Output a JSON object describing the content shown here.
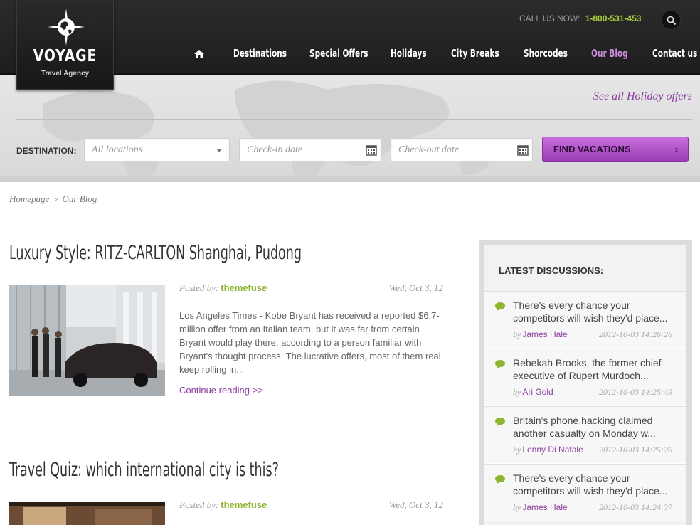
{
  "brand": {
    "name": "VOYAGE",
    "tagline": "Travel Agency"
  },
  "header": {
    "call_label": "CALL US NOW:",
    "phone": "1-800-531-453",
    "nav": [
      "Destinations",
      "Special Offers",
      "Holidays",
      "City Breaks",
      "Shorcodes",
      "Our Blog",
      "Contact us"
    ],
    "active_nav": "Our Blog"
  },
  "search": {
    "see_all": "See all Holiday offers",
    "destination_label": "DESTINATION:",
    "location_placeholder": "All locations",
    "checkin_placeholder": "Check-in date",
    "checkout_placeholder": "Check-out date",
    "submit": "FIND VACATIONS",
    "submit_arrow": "›"
  },
  "breadcrumb": {
    "home": "Homepage",
    "sep": ">",
    "current": "Our Blog"
  },
  "posts": [
    {
      "title": "Luxury Style: RITZ-CARLTON Shanghai, Pudong",
      "posted_by_label": "Posted by:",
      "author": "themefuse",
      "date": "Wed, Oct 3, 12",
      "excerpt": "Los Angeles Times - Kobe Bryant has received a reported $6.7-million offer from an Italian team, but it was far from certain Bryant would play there, according to a person familiar with Bryant's thought process. The lucrative offers, most of them real, keep rolling in...",
      "continue": "Continue reading >>"
    },
    {
      "title": "Travel Quiz: which international city is this?",
      "posted_by_label": "Posted by:",
      "author": "themefuse",
      "date": "Wed, Oct 3, 12"
    }
  ],
  "sidebar": {
    "title": "LATEST DISCUSSIONS:",
    "by_label": "by",
    "items": [
      {
        "text": "There's every chance your\ncompetitors will wish they'd place...",
        "author": "James Hale",
        "date": "2012-10-03 14:26:26"
      },
      {
        "text": "Rebekah Brooks, the former chief\nexecutive of Rupert Murdoch...",
        "author": "Ari Gold",
        "date": "2012-10-03 14:25:49"
      },
      {
        "text": "Britain's phone hacking claimed\nanother casualty on Monday w...",
        "author": "Lenny Di Natale",
        "date": "2012-10-03 14:25:26"
      },
      {
        "text": "There's every chance your\ncompetitors will wish they'd place...",
        "author": "James Hale",
        "date": "2012-10-03 14:24:37"
      }
    ]
  },
  "colors": {
    "accent": "#8b3fa0",
    "author_green": "#8db52e",
    "phone_green": "#a9d03a",
    "header_bg": "#222222"
  }
}
